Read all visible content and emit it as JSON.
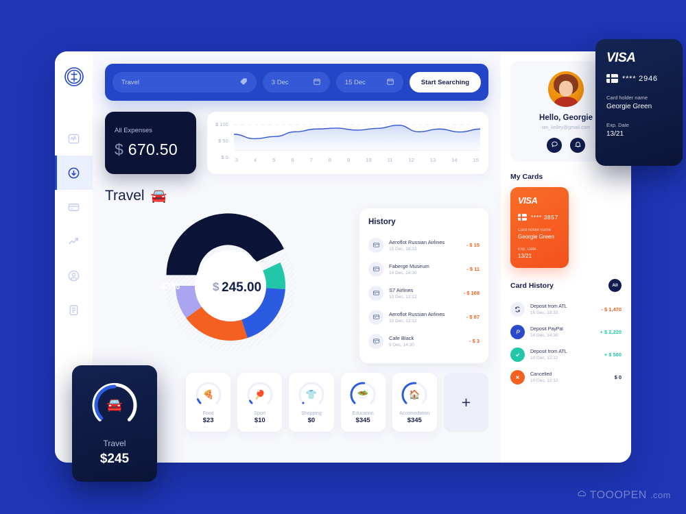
{
  "brand": {
    "logo_icon": "dollar-circle-logo",
    "accent": "#2346C8",
    "dark": "#0B1437",
    "orange": "#F4601F",
    "teal": "#22C7A9"
  },
  "sidebar": {
    "items": [
      {
        "icon": "activity-chart-icon",
        "name": "analytics",
        "active": false
      },
      {
        "icon": "download-circle-icon",
        "name": "deposits",
        "active": true
      },
      {
        "icon": "credit-card-icon",
        "name": "cards",
        "active": false
      },
      {
        "icon": "trending-up-icon",
        "name": "statistics",
        "active": false
      },
      {
        "icon": "user-circle-icon",
        "name": "profile",
        "active": false
      },
      {
        "icon": "document-icon",
        "name": "reports",
        "active": false
      }
    ]
  },
  "search": {
    "query_value": "Travel",
    "tag_icon": "tag-icon",
    "date_from": "3 Dec",
    "date_to": "15 Dec",
    "calendar_icon": "calendar-icon",
    "button_label": "Start Searching"
  },
  "expenses": {
    "label": "All Expenses",
    "currency": "$",
    "amount": "670.50"
  },
  "chart_data": {
    "type": "area",
    "title": "",
    "xlabel": "",
    "ylabel": "",
    "ylim": [
      0,
      125
    ],
    "ytick_labels": [
      "$ 100",
      "$ 50",
      "$ 0"
    ],
    "yticks": [
      100,
      50,
      0
    ],
    "grid": true,
    "legend": "none",
    "categories": [
      "3",
      "4",
      "5",
      "6",
      "7",
      "8",
      "9",
      "10",
      "11",
      "12",
      "13",
      "14",
      "15"
    ],
    "values": [
      72,
      52,
      62,
      83,
      95,
      99,
      90,
      98,
      112,
      83,
      95,
      82,
      95
    ],
    "line_color": "#3558D6",
    "fill_color": "#C9D6F7"
  },
  "travel_section": {
    "title": "Travel",
    "emoji": "🚘"
  },
  "donut": {
    "type": "pie",
    "center_currency": "$",
    "center_amount": "245.00",
    "highlight_label": "43%",
    "segments": [
      {
        "name": "Travel",
        "percent": 43,
        "color": "#0B1437",
        "exploded": true
      },
      {
        "name": "Education",
        "percent": 8,
        "color": "#22C7A9",
        "exploded": false
      },
      {
        "name": "Accomodation",
        "percent": 19,
        "color": "#2B5BE0",
        "exploded": false
      },
      {
        "name": "Food",
        "percent": 20,
        "color": "#F4601F",
        "exploded": false
      },
      {
        "name": "Sport",
        "percent": 10,
        "color": "#A9A5F0",
        "exploded": false
      }
    ]
  },
  "history": {
    "title": "History",
    "items": [
      {
        "icon": "credit-card-icon",
        "name": "Aeroflot Russian Airlines",
        "date": "15 Dec, 18:33",
        "amount": "- $ 15"
      },
      {
        "icon": "credit-card-icon",
        "name": "Faberge Museum",
        "date": "14 Dec, 14:30",
        "amount": "- $ 11"
      },
      {
        "icon": "credit-card-icon",
        "name": "S7 Airlines",
        "date": "10 Dec, 12:12",
        "amount": "- $ 108"
      },
      {
        "icon": "credit-card-icon",
        "name": "Aeroflot Russian Airlines",
        "date": "10 Dec, 12:12",
        "amount": "- $ 87"
      },
      {
        "icon": "credit-card-icon",
        "name": "Cafe Black",
        "date": "9 Dec, 14:30",
        "amount": "- $ 3"
      }
    ]
  },
  "categories": {
    "items": [
      {
        "emoji": "🍕",
        "name": "Food",
        "value": "$23",
        "progress": 8
      },
      {
        "emoji": "🏓",
        "name": "Sport",
        "value": "$10",
        "progress": 5
      },
      {
        "emoji": "👕",
        "name": "Shopping",
        "value": "$0",
        "progress": 0
      },
      {
        "emoji": "🥗",
        "name": "Education",
        "value": "$345",
        "progress": 52
      },
      {
        "emoji": "🏠",
        "name": "Accomodation",
        "value": "$345",
        "progress": 52
      }
    ],
    "add_label": "+"
  },
  "travel_card": {
    "emoji": "🚘",
    "name": "Travel",
    "value": "$245",
    "progress": 50
  },
  "profile": {
    "greeting": "Hello, Georgie",
    "email": "ian_kelley@gmail.com",
    "avatar_icon": "avatar",
    "actions": [
      {
        "icon": "chat-bubble-icon",
        "name": "messages"
      },
      {
        "icon": "bell-icon",
        "name": "notifications"
      }
    ]
  },
  "cards": {
    "title": "My Cards",
    "orange_card": {
      "brand": "VISA",
      "masked": "**** 3857",
      "holder_label": "Card holder name",
      "holder_name": "Georgie Green",
      "exp_label": "Exp. Date",
      "exp_value": "13/21"
    },
    "dark_card": {
      "brand": "VISA",
      "masked": "**** 2946",
      "holder_label": "Card holder name",
      "holder_name": "Georgie Green",
      "exp_label": "Exp. Date",
      "exp_value": "13/21"
    }
  },
  "card_history": {
    "title": "Card History",
    "filter_badge": "All",
    "items": [
      {
        "icon": "refresh-icon",
        "icon_bg": "#EDF0FA",
        "icon_color": "#20294F",
        "name": "Deposit from ATL",
        "date": "15 Dec, 18:33",
        "amount": "- $ 1,470",
        "amount_color": "#F4601F"
      },
      {
        "icon": "paypal-icon",
        "icon_bg": "#2B4ACB",
        "icon_color": "#ffffff",
        "name": "Deposit PayPal",
        "date": "14 Dec, 14:30",
        "amount": "+ $ 2,220",
        "amount_color": "#22C7A9"
      },
      {
        "icon": "check-icon",
        "icon_bg": "#22C7A9",
        "icon_color": "#ffffff",
        "name": "Deposit from ATL",
        "date": "10 Dec, 12:12",
        "amount": "+  $ 500",
        "amount_color": "#22C7A9"
      },
      {
        "icon": "close-icon",
        "icon_bg": "#F4601F",
        "icon_color": "#ffffff",
        "name": "Cancelled",
        "date": "10 Dec, 12:12",
        "amount": "$ 0",
        "amount_color": "#141F4B"
      }
    ]
  },
  "watermark": {
    "brand": "TOOOPEN",
    "domain": ".com",
    "icon": "cloud-icon"
  }
}
